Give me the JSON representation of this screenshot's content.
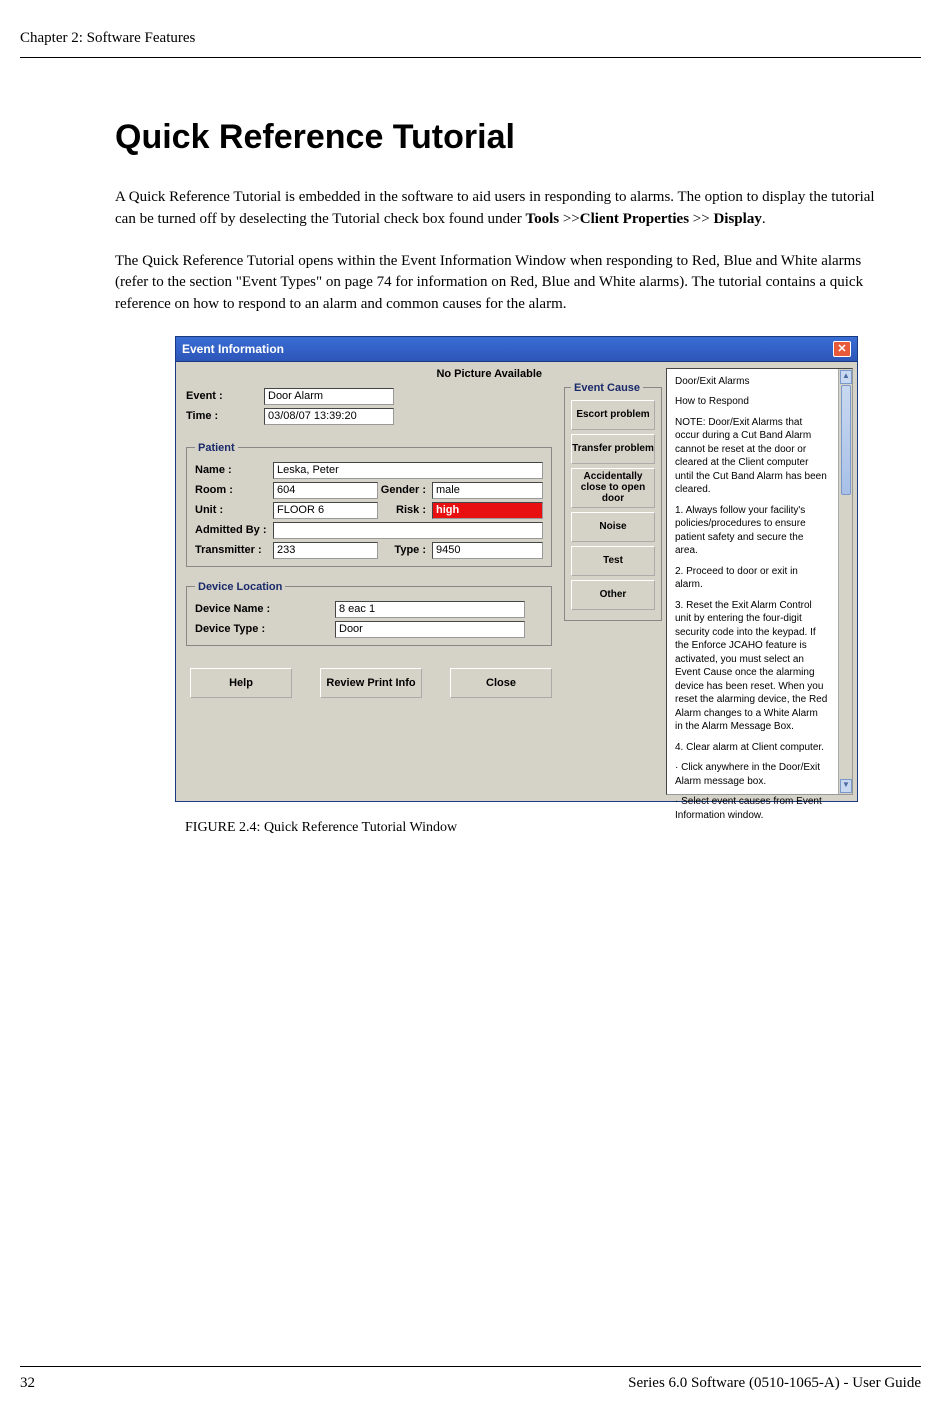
{
  "header": {
    "chapter": "Chapter 2: Software Features"
  },
  "title": "Quick Reference Tutorial",
  "para1_a": "A Quick Reference Tutorial is embedded in the software to aid users in responding to alarms. The option to display the tutorial can be turned off by deselecting the Tutorial check box found under ",
  "para1_b": "Tools",
  "para1_c": " >>",
  "para1_d": "Client Properties",
  "para1_e": " >> ",
  "para1_f": "Display",
  "para1_g": ".",
  "para2": "The Quick Reference Tutorial opens within the Event Information Window when responding to Red, Blue and White alarms (refer to the section \"Event Types\" on page 74 for information on Red, Blue and White alarms). The tutorial contains a quick reference on how to respond to an alarm and common causes for the alarm.",
  "window": {
    "title": "Event Information",
    "no_picture": "No Picture Available",
    "labels": {
      "event": "Event :",
      "time": "Time :",
      "patient": "Patient",
      "name": "Name :",
      "room": "Room :",
      "gender": "Gender :",
      "unit": "Unit :",
      "risk": "Risk :",
      "admitted": "Admitted By :",
      "transmitter": "Transmitter :",
      "type": "Type :",
      "device_location": "Device Location",
      "device_name": "Device Name :",
      "device_type": "Device Type :"
    },
    "values": {
      "event": "Door Alarm",
      "time": "03/08/07 13:39:20",
      "name": "Leska, Peter",
      "room": "604",
      "gender": "male",
      "unit": "FLOOR 6",
      "risk": "high",
      "admitted": "",
      "transmitter": "233",
      "type": "9450",
      "device_name": "8 eac 1",
      "device_type": "Door"
    },
    "event_cause": {
      "legend": "Event Cause",
      "buttons": [
        "Escort problem",
        "Transfer problem",
        "Accidentally close to open door",
        "Noise",
        "Test",
        "Other"
      ]
    },
    "bottom_buttons": [
      "Help",
      "Review Print Info",
      "Close"
    ],
    "tutorial": {
      "h1": "Door/Exit Alarms",
      "h2": "How to Respond",
      "note": "NOTE: Door/Exit Alarms that occur during a Cut Band Alarm cannot be reset at the door or cleared at the Client computer until the Cut Band Alarm has been cleared.",
      "s1": "1. Always follow your facility's policies/procedures to ensure patient safety and secure the area.",
      "s2": "2. Proceed to door or exit in alarm.",
      "s3": "3. Reset the Exit Alarm Control unit by entering the four-digit security code into the keypad. If the Enforce JCAHO feature is activated, you must select an Event Cause once the alarming device has been reset. When you reset the alarming device, the Red Alarm changes to a White Alarm in the Alarm Message Box.",
      "s4": "4. Clear alarm at Client computer.",
      "s4a": "· Click anywhere in the Door/Exit Alarm message box.",
      "s4b": "· Select event causes from Event Information window."
    }
  },
  "figure_caption": "FIGURE 2.4:    Quick Reference Tutorial Window",
  "footer": {
    "page": "32",
    "doc": "Series 6.0 Software (0510-1065-A) - User Guide"
  }
}
